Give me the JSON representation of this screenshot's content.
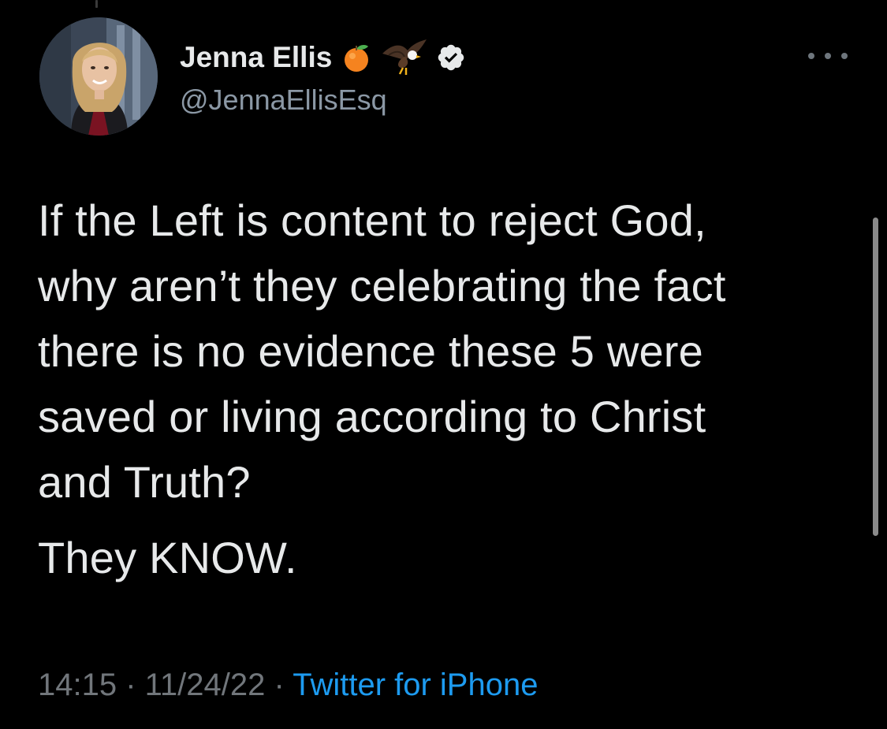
{
  "author": {
    "display_name": "Jenna Ellis",
    "handle": "@JennaEllisEsq",
    "badges": [
      "orange-emoji",
      "eagle-emoji",
      "verified-badge"
    ]
  },
  "tweet": {
    "paragraphs": [
      {
        "lines": [
          "If the Left is content to reject God,",
          "why aren’t they celebrating the fact",
          "there is no evidence these 5 were",
          "saved or living according to Christ",
          "and Truth?"
        ]
      },
      {
        "lines": [
          "They KNOW."
        ]
      }
    ]
  },
  "meta": {
    "time": "14:15",
    "separator": " · ",
    "date": "11/24/22",
    "source": "Twitter for iPhone"
  },
  "colors": {
    "background": "#000000",
    "primary_text": "#e7e9ea",
    "secondary_text": "#71767b",
    "accent": "#1d9bf0"
  }
}
